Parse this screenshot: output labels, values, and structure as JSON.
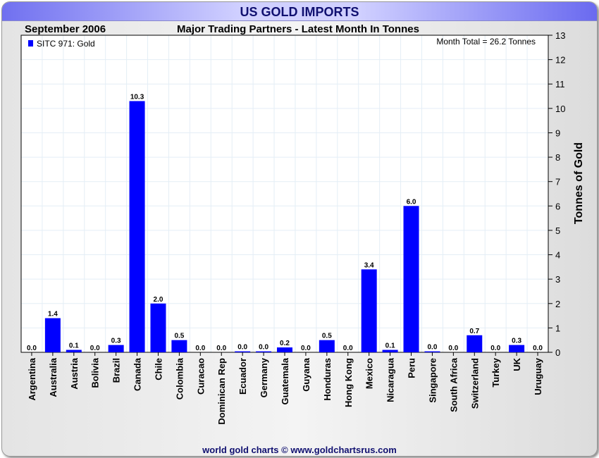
{
  "header": {
    "title": "US GOLD IMPORTS",
    "date": "September 2006",
    "subtitle": "Major Trading Partners - Latest Month In Tonnes"
  },
  "footer": "world gold charts © www.goldchartsrus.com",
  "chart_data": {
    "type": "bar",
    "title": "US GOLD IMPORTS",
    "subtitle": "Major Trading Partners - Latest Month In Tonnes",
    "ylabel": "Tonnes of Gold",
    "ylim": [
      0,
      13
    ],
    "yticks": [
      0,
      1,
      2,
      3,
      4,
      5,
      6,
      7,
      8,
      9,
      10,
      11,
      12,
      13
    ],
    "legend": {
      "label": "SITC 971: Gold",
      "position": "top-left"
    },
    "annotation": "Month Total = 26.2 Tonnes",
    "bar_color": "#0000ff",
    "grid": true,
    "categories": [
      "Argentina",
      "Australia",
      "Austria",
      "Bolivia",
      "Brazil",
      "Canada",
      "Chile",
      "Colombia",
      "Curacao",
      "Dominican Rep",
      "Ecuador",
      "Germany",
      "Guatemala",
      "Guyana",
      "Honduras",
      "Hong Kong",
      "Mexico",
      "Nicaragua",
      "Peru",
      "Singapore",
      "South Africa",
      "Switzerland",
      "Turkey",
      "UK",
      "Uruguay"
    ],
    "values": [
      0.0,
      1.4,
      0.1,
      0.0,
      0.3,
      10.3,
      2.0,
      0.5,
      0.0,
      0.0,
      0.04,
      0.04,
      0.2,
      0.0,
      0.5,
      0.0,
      3.4,
      0.1,
      6.0,
      0.04,
      0.0,
      0.7,
      0.0,
      0.3,
      0.0
    ],
    "labels": [
      "0.0",
      "1.4",
      "0.1",
      "0.0",
      "0.3",
      "10.3",
      "2.0",
      "0.5",
      "0.0",
      "0.0",
      "0.0",
      "0.0",
      "0.2",
      "0.0",
      "0.5",
      "0.0",
      "3.4",
      "0.1",
      "6.0",
      "0.0",
      "0.0",
      "0.7",
      "0.0",
      "0.3",
      "0.0"
    ]
  }
}
